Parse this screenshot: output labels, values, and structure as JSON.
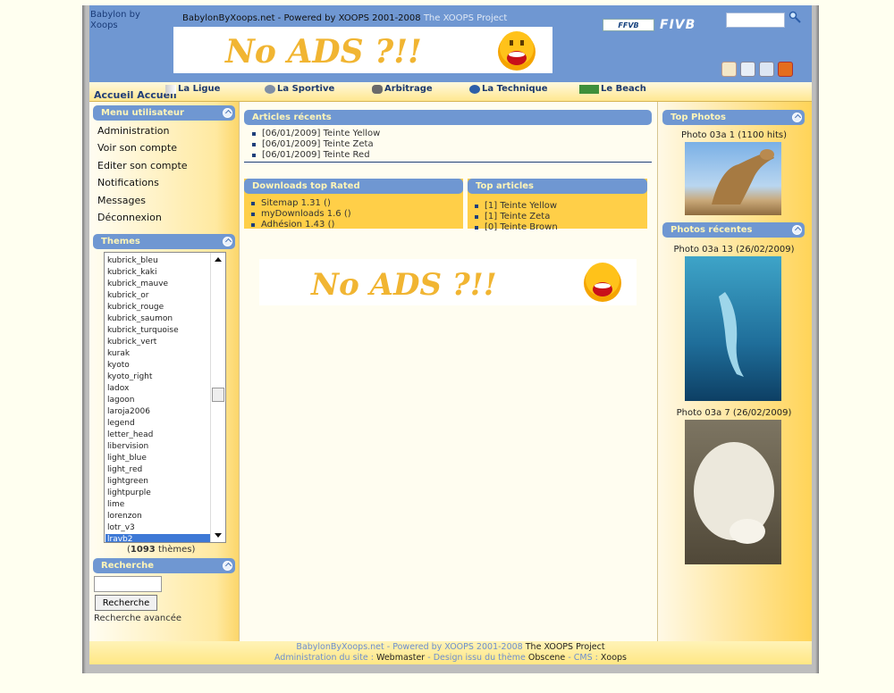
{
  "header": {
    "site_name": "Babylon by Xoops",
    "slogan_main": "BabylonByXoops.net - Powered by XOOPS 2001-2008",
    "slogan_project": "The XOOPS Project",
    "banner_text": "No ADS ?!!",
    "logo_ffvb": "FFVB",
    "logo_fivb": "FIVB"
  },
  "nav": {
    "home": "Accueil Accueil",
    "items": [
      "La Ligue",
      "La Sportive",
      "Arbitrage",
      "La Technique",
      "Le Beach"
    ]
  },
  "left": {
    "menu_title": "Menu utilisateur",
    "menu_items": [
      "Administration",
      "Voir son compte",
      "Editer son compte",
      "Notifications",
      "Messages",
      "Déconnexion"
    ],
    "themes_title": "Themes",
    "themes": [
      "kubrick_bleu",
      "kubrick_kaki",
      "kubrick_mauve",
      "kubrick_or",
      "kubrick_rouge",
      "kubrick_saumon",
      "kubrick_turquoise",
      "kubrick_vert",
      "kurak",
      "kyoto",
      "kyoto_right",
      "ladox",
      "lagoon",
      "laroja2006",
      "legend",
      "letter_head",
      "libervision",
      "light_blue",
      "light_red",
      "lightgreen",
      "lightpurple",
      "lime",
      "lorenzon",
      "lotr_v3",
      "lravb2"
    ],
    "themes_count": "1093",
    "themes_count_suffix": "thèmes",
    "search_title": "Recherche",
    "search_button": "Recherche",
    "search_advanced": "Recherche avancée"
  },
  "center": {
    "recent_title": "Articles récents",
    "recent": [
      "[06/01/2009] Teinte Yellow",
      "[06/01/2009] Teinte Zeta",
      "[06/01/2009] Teinte Red"
    ],
    "downloads_title": "Downloads top Rated",
    "downloads": [
      "Sitemap 1.31 ()",
      "myDownloads 1.6 ()",
      "Adhésion 1.43 ()"
    ],
    "top_title": "Top articles",
    "top": [
      "[1] Teinte Yellow",
      "[1] Teinte Zeta",
      "[0] Teinte Brown"
    ],
    "ads_text": "No ADS ?!!"
  },
  "right": {
    "top_photos_title": "Top Photos",
    "top_photo_caption": "Photo 03a 1 (1100 hits)",
    "recent_photos_title": "Photos récentes",
    "recent_photo1_caption": "Photo 03a 13 (26/02/2009)",
    "recent_photo2_caption": "Photo 03a 7 (26/02/2009)"
  },
  "footer": {
    "line1_a": "BabylonByXoops.net - Powered by XOOPS 2001-2008",
    "line1_b": "The XOOPS Project",
    "line2_a": "Administration du site :",
    "line2_b": "Webmaster",
    "line2_c": "- Design issu du thème",
    "line2_d": "Obscene",
    "line2_e": "- CMS :",
    "line2_f": "Xoops"
  },
  "colors": {
    "accent": "#6f97d2",
    "block_yellow": "#ffcf48",
    "header_blue": "#6f97d2"
  }
}
